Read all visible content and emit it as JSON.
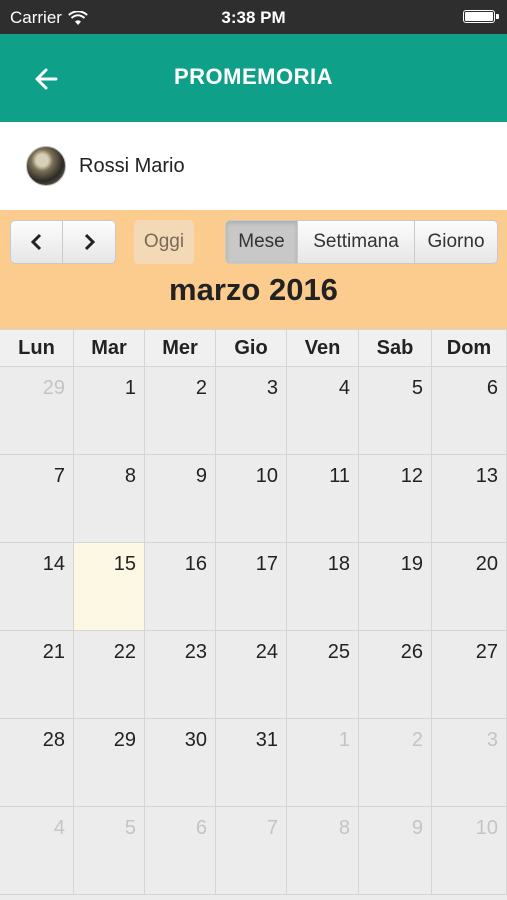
{
  "status_bar": {
    "carrier": "Carrier",
    "time": "3:38 PM"
  },
  "nav": {
    "title": "PROMEMORIA",
    "back_icon": "arrow-left-icon"
  },
  "user": {
    "name": "Rossi Mario"
  },
  "calendar": {
    "prev_icon": "chevron-left-icon",
    "next_icon": "chevron-right-icon",
    "today_label": "Oggi",
    "views": {
      "month": "Mese",
      "week": "Settimana",
      "day": "Giorno"
    },
    "active_view": "Mese",
    "month_title": "marzo 2016",
    "weekdays": [
      "Lun",
      "Mar",
      "Mer",
      "Gio",
      "Ven",
      "Sab",
      "Dom"
    ],
    "weeks": [
      [
        {
          "d": "29",
          "other": true
        },
        {
          "d": "1"
        },
        {
          "d": "2"
        },
        {
          "d": "3"
        },
        {
          "d": "4"
        },
        {
          "d": "5"
        },
        {
          "d": "6"
        }
      ],
      [
        {
          "d": "7"
        },
        {
          "d": "8"
        },
        {
          "d": "9"
        },
        {
          "d": "10"
        },
        {
          "d": "11"
        },
        {
          "d": "12"
        },
        {
          "d": "13"
        }
      ],
      [
        {
          "d": "14"
        },
        {
          "d": "15",
          "today": true
        },
        {
          "d": "16"
        },
        {
          "d": "17"
        },
        {
          "d": "18"
        },
        {
          "d": "19"
        },
        {
          "d": "20"
        }
      ],
      [
        {
          "d": "21"
        },
        {
          "d": "22"
        },
        {
          "d": "23"
        },
        {
          "d": "24"
        },
        {
          "d": "25"
        },
        {
          "d": "26"
        },
        {
          "d": "27"
        }
      ],
      [
        {
          "d": "28"
        },
        {
          "d": "29"
        },
        {
          "d": "30"
        },
        {
          "d": "31"
        },
        {
          "d": "1",
          "other": true
        },
        {
          "d": "2",
          "other": true
        },
        {
          "d": "3",
          "other": true
        }
      ],
      [
        {
          "d": "4",
          "other": true
        },
        {
          "d": "5",
          "other": true
        },
        {
          "d": "6",
          "other": true
        },
        {
          "d": "7",
          "other": true
        },
        {
          "d": "8",
          "other": true
        },
        {
          "d": "9",
          "other": true
        },
        {
          "d": "10",
          "other": true
        }
      ]
    ],
    "colors": {
      "header_bg": "#fccc8e",
      "today_bg": "#fcf8e3",
      "nav_bg": "#0fa08a"
    }
  }
}
